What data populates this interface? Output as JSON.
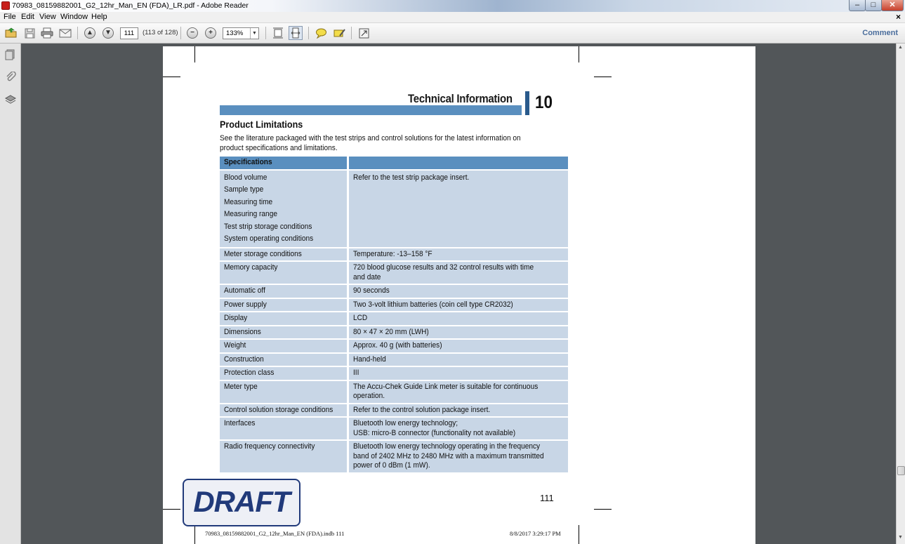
{
  "window": {
    "title": "70983_08159882001_G2_12hr_Man_EN (FDA)_LR.pdf - Adobe Reader",
    "minimize": "–",
    "maximize": "□",
    "close": "✕"
  },
  "menu": {
    "items": [
      "File",
      "Edit",
      "View",
      "Window",
      "Help"
    ],
    "close": "×"
  },
  "toolbar": {
    "page_value": "111",
    "page_count": "(113 of 128)",
    "zoom_value": "133%",
    "zoom_dropdown": "▼",
    "comment_label": "Comment",
    "prev_page": "▲",
    "next_page": "▼",
    "zoom_out": "−",
    "zoom_in": "+"
  },
  "scroll": {
    "up": "▲",
    "down": "▼"
  },
  "document": {
    "section_title": "Technical Information",
    "chapter_number": "10",
    "heading": "Product Limitations",
    "intro": "See the literature packaged with the test strips and control solutions for the latest information on product specifications and limitations.",
    "table": {
      "header": [
        "Specifications",
        ""
      ],
      "rows": [
        {
          "label": [
            "Blood volume",
            "Sample type",
            "Measuring time",
            "Measuring range",
            "Test strip storage conditions",
            "System operating conditions"
          ],
          "value": "Refer to the test strip package insert."
        },
        {
          "label": "Meter storage conditions",
          "value": "Temperature: -13–158 °F"
        },
        {
          "label": "Memory capacity",
          "value": "720 blood glucose results and 32 control results with time and date"
        },
        {
          "label": "Automatic off",
          "value": "90 seconds"
        },
        {
          "label": "Power supply",
          "value": "Two 3-volt lithium batteries (coin cell type CR2032)"
        },
        {
          "label": "Display",
          "value": "LCD"
        },
        {
          "label": "Dimensions",
          "value": "80 × 47 × 20 mm (LWH)"
        },
        {
          "label": "Weight",
          "value": "Approx. 40 g (with batteries)"
        },
        {
          "label": "Construction",
          "value": "Hand-held"
        },
        {
          "label": "Protection class",
          "value": "III"
        },
        {
          "label": "Meter type",
          "value": "The Accu-Chek Guide Link meter is suitable for continuous operation."
        },
        {
          "label": "Control solution storage conditions",
          "value": "Refer to the control solution package insert."
        },
        {
          "label": "Interfaces",
          "value": [
            "Bluetooth low energy technology;",
            "USB: micro-B connector (functionality not available)"
          ]
        },
        {
          "label": "Radio frequency connectivity",
          "value": "Bluetooth low energy technology operating in the frequency band of 2402 MHz to 2480 MHz with a maximum transmitted power of 0 dBm (1 mW)."
        }
      ]
    },
    "page_number": "111",
    "draft_stamp": "DRAFT",
    "footer_file": "70983_08159882001_G2_12hr_Man_EN (FDA).indb   111",
    "footer_date": "8/8/2017   3:29:17 PM"
  }
}
